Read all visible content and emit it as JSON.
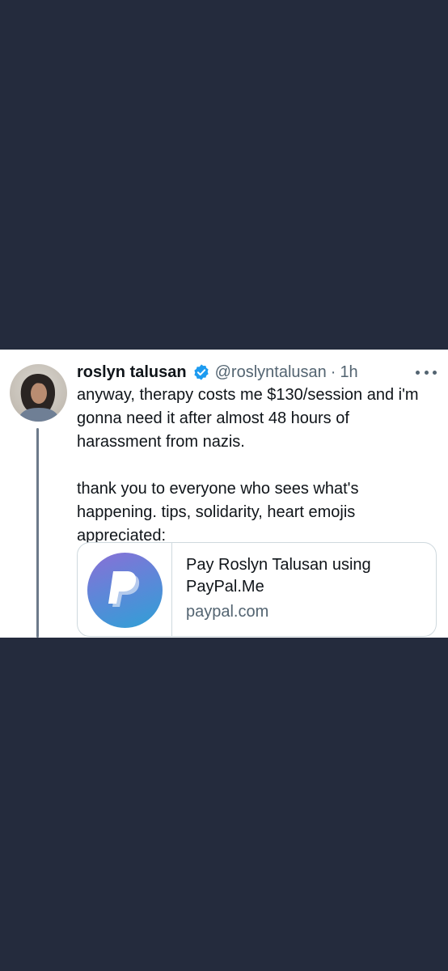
{
  "tweet": {
    "display_name": "roslyn talusan",
    "handle": "@roslyntalusan",
    "separator": "·",
    "time": "1h",
    "paragraphs": [
      "anyway, therapy costs me $130/session and i'm gonna need it after almost 48 hours of harassment from nazis.",
      "thank you to everyone who sees what's happening. tips, solidarity, heart emojis appreciated:"
    ],
    "card": {
      "title": "Pay Roslyn Talusan using PayPal.Me",
      "domain": "paypal.com",
      "logo_icon": "paypal-logo-icon"
    }
  },
  "colors": {
    "background": "#242b3d",
    "verified": "#1d9bf0",
    "thread_line": "#6d7a8a"
  }
}
